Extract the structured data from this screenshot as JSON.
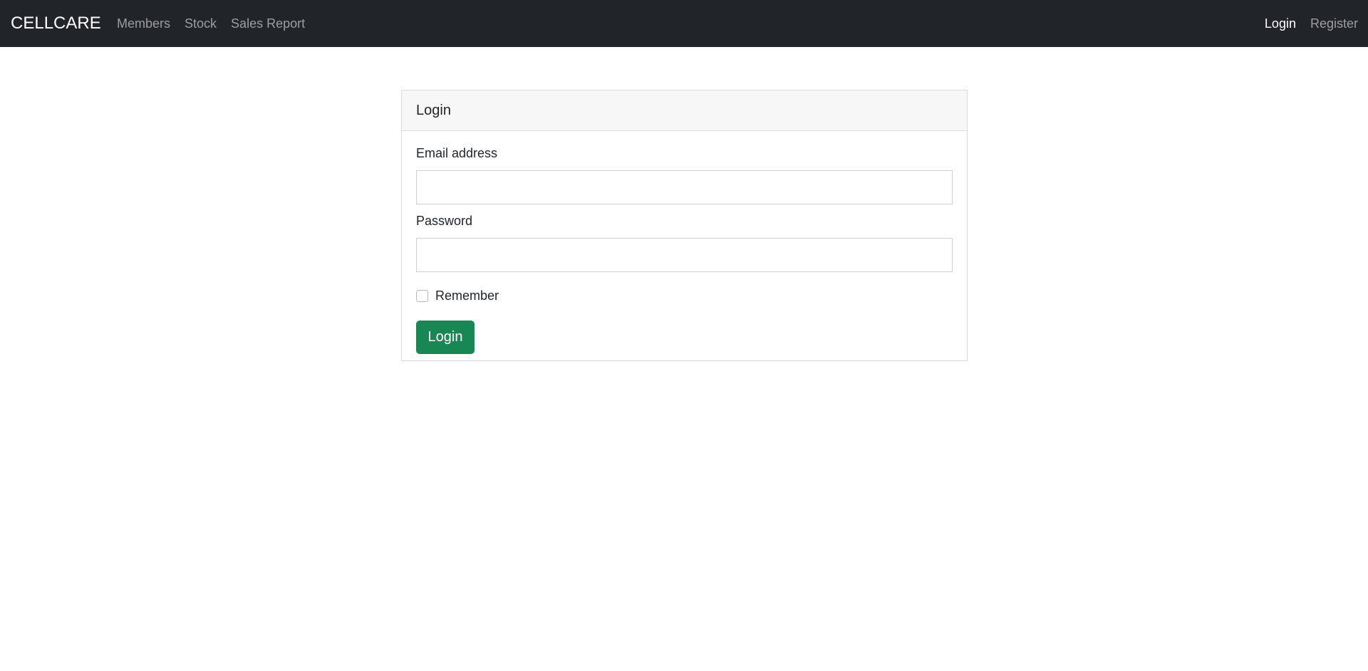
{
  "navbar": {
    "brand": "CELLCARE",
    "left_links": [
      "Members",
      "Stock",
      "Sales Report"
    ],
    "right_links": [
      {
        "label": "Login",
        "active": true
      },
      {
        "label": "Register",
        "active": false
      }
    ]
  },
  "login_card": {
    "header": "Login",
    "email_label": "Email address",
    "email_value": "",
    "password_label": "Password",
    "password_value": "",
    "remember_label": "Remember",
    "remember_checked": false,
    "submit_label": "Login"
  },
  "colors": {
    "navbar_bg": "#212529",
    "button_bg": "#198754",
    "card_header_bg": "#f7f7f7"
  }
}
